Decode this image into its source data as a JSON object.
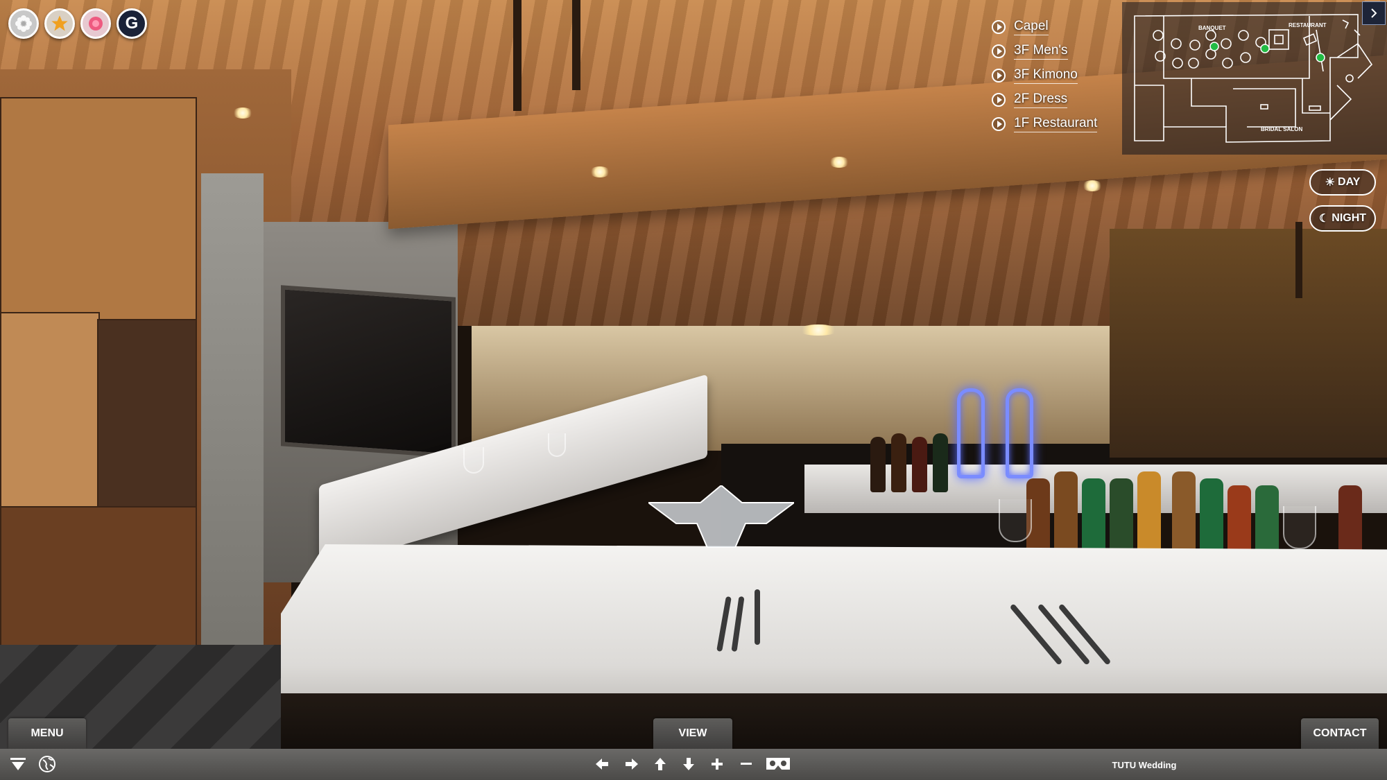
{
  "header_icons": [
    {
      "name": "flower-icon",
      "color": "#d8d8d8"
    },
    {
      "name": "star-icon",
      "color": "#f0a020"
    },
    {
      "name": "pink-flower-icon",
      "color": "#ee6688"
    },
    {
      "name": "google-icon",
      "glyph": "G",
      "color": "#1a2238"
    }
  ],
  "floor_menu": [
    {
      "label": "Capel"
    },
    {
      "label": "3F Men's"
    },
    {
      "label": "3F Kimono"
    },
    {
      "label": "2F Dress"
    },
    {
      "label": "1F Restaurant"
    }
  ],
  "floor_plan": {
    "labels": {
      "banquet": "BANQUET",
      "restaurant": "RESTAURANT",
      "bridal_salon": "BRIDAL SALON"
    },
    "toggle_icon": "chevron-right-icon"
  },
  "lighting": {
    "day_icon": "☀",
    "day_label": "DAY",
    "night_icon": "☾",
    "night_label": "NIGHT"
  },
  "tabs": {
    "menu": "MENU",
    "view": "VIEW",
    "contact": "CONTACT"
  },
  "bottom_bar": {
    "icons": [
      "dropdown-icon",
      "globe-icon",
      "arrow-left-icon",
      "arrow-right-icon",
      "arrow-up-icon",
      "arrow-down-icon",
      "zoom-in-icon",
      "zoom-out-icon",
      "vr-headset-icon"
    ],
    "brand": "TUTU Wedding"
  },
  "colors": {
    "bar_bg": "#555452",
    "accent_hotspot": "#22bb44",
    "map_line": "#ffffff"
  }
}
